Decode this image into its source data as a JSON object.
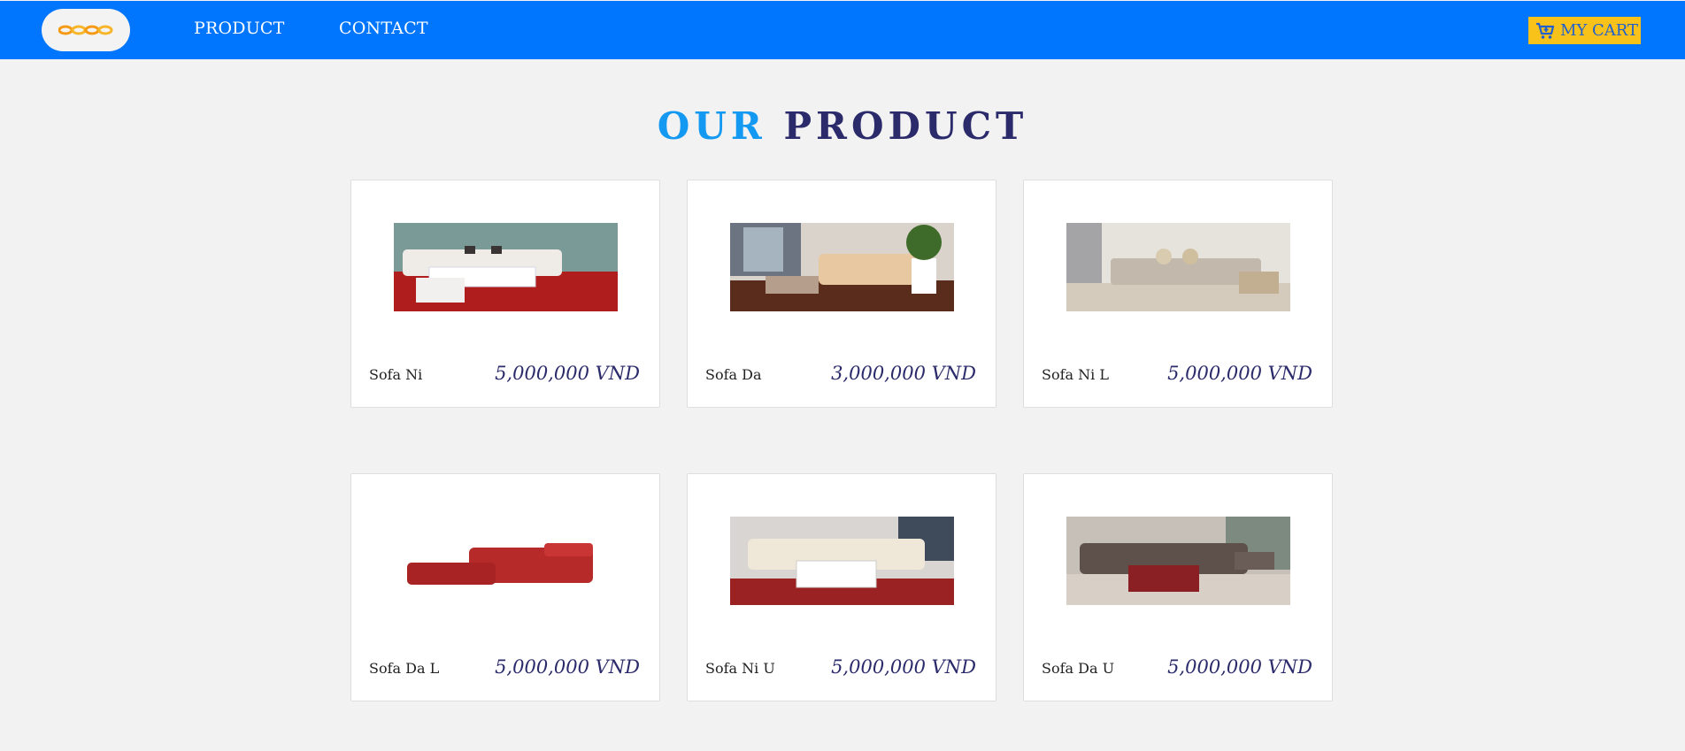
{
  "header": {
    "logo_alt": "logo",
    "nav": [
      {
        "label": "PRODUCT"
      },
      {
        "label": "CONTACT"
      }
    ],
    "cart_label": "MY CART",
    "cart_icon": "cart-icon",
    "colors": {
      "navbar": "#0076fe",
      "cart_bg": "#f9c21a"
    }
  },
  "main": {
    "title_part1": "OUR",
    "title_part2": "PRODUCT",
    "products": [
      {
        "name": "Sofa Ni",
        "price": "5,000,000 VND"
      },
      {
        "name": "Sofa Da",
        "price": "3,000,000 VND"
      },
      {
        "name": "Sofa Ni L",
        "price": "5,000,000 VND"
      },
      {
        "name": "Sofa Da L",
        "price": "5,000,000 VND"
      },
      {
        "name": "Sofa Ni U",
        "price": "5,000,000 VND"
      },
      {
        "name": "Sofa Da U",
        "price": "5,000,000 VND"
      }
    ]
  }
}
